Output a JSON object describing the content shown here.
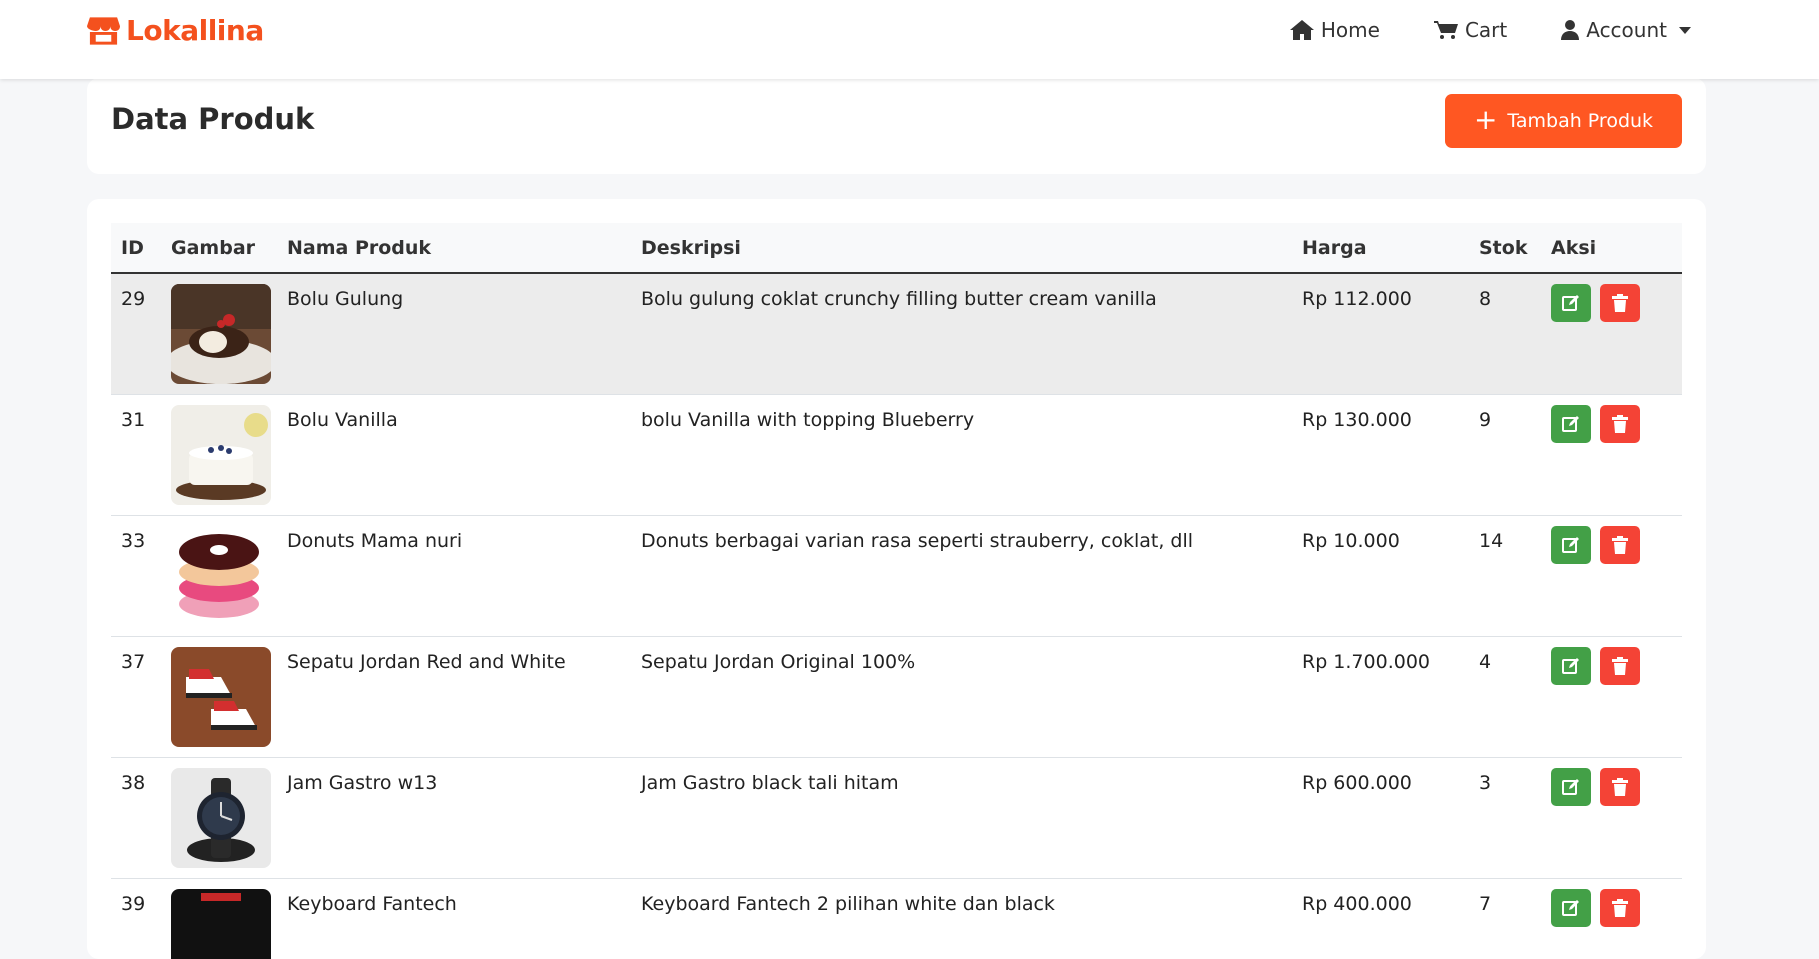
{
  "app": {
    "brand": "Lokallina"
  },
  "nav": {
    "home": "Home",
    "cart": "Cart",
    "account": "Account"
  },
  "page": {
    "title": "Data Produk",
    "add_button": "Tambah Produk"
  },
  "table": {
    "columns": [
      "ID",
      "Gambar",
      "Nama Produk",
      "Deskripsi",
      "Harga",
      "Stok",
      "Aksi"
    ],
    "rows": [
      {
        "id": "29",
        "image": "bolu-gulung-photo",
        "name": "Bolu Gulung",
        "desc": "Bolu gulung coklat crunchy filling butter cream vanilla",
        "price": "Rp 112.000",
        "stock": "8"
      },
      {
        "id": "31",
        "image": "bolu-vanilla-photo",
        "name": "Bolu Vanilla",
        "desc": "bolu Vanilla with topping Blueberry",
        "price": "Rp 130.000",
        "stock": "9"
      },
      {
        "id": "33",
        "image": "donuts-photo",
        "name": "Donuts Mama nuri",
        "desc": "Donuts berbagai varian rasa seperti strauberry, coklat, dll",
        "price": "Rp 10.000",
        "stock": "14"
      },
      {
        "id": "37",
        "image": "sepatu-jordan-photo",
        "name": "Sepatu Jordan Red and White",
        "desc": "Sepatu Jordan Original 100%",
        "price": "Rp 1.700.000",
        "stock": "4"
      },
      {
        "id": "38",
        "image": "jam-gastro-photo",
        "name": "Jam Gastro w13",
        "desc": "Jam Gastro black tali hitam",
        "price": "Rp 600.000",
        "stock": "3"
      },
      {
        "id": "39",
        "image": "keyboard-photo",
        "name": "Keyboard Fantech",
        "desc": "Keyboard Fantech 2 pilihan white dan black",
        "price": "Rp 400.000",
        "stock": "7"
      }
    ]
  },
  "colors": {
    "brand": "#f4511e",
    "primary_button": "#ff5722",
    "edit": "#43a047",
    "delete": "#f44336"
  }
}
